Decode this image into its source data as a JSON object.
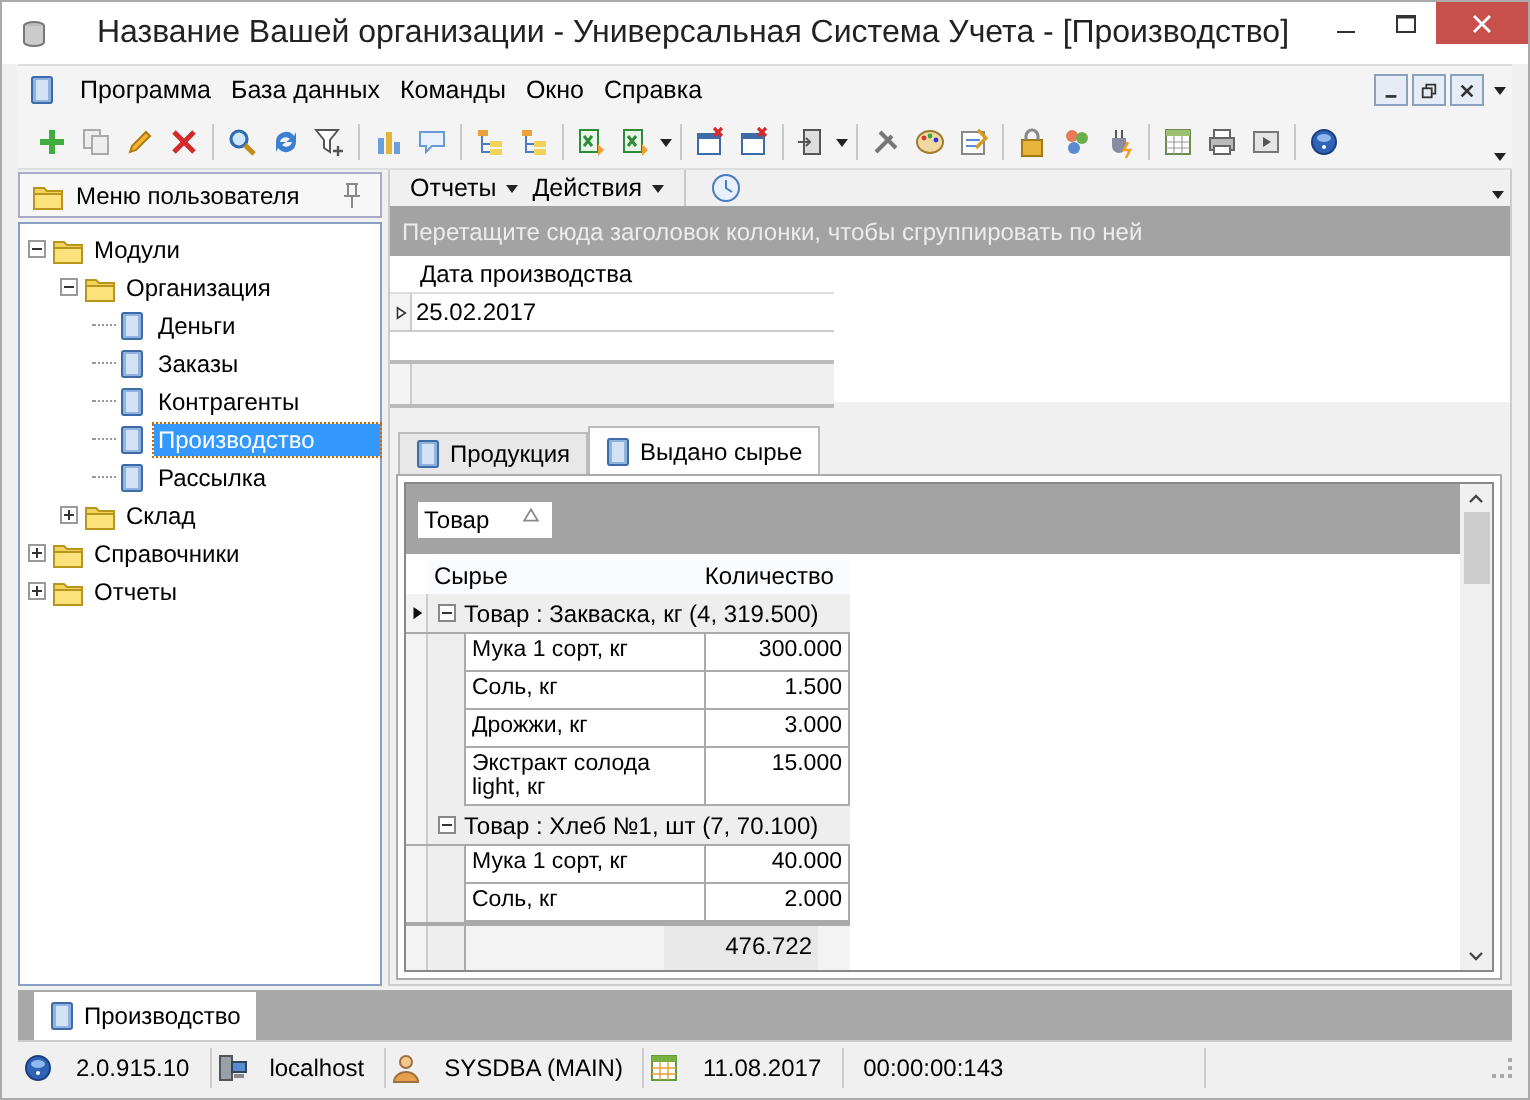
{
  "window": {
    "title": "Название Вашей организации - Универсальная Система Учета - [Производство]"
  },
  "menu": [
    "Программа",
    "База данных",
    "Команды",
    "Окно",
    "Справка"
  ],
  "sidebar": {
    "title": "Меню пользователя",
    "tree": [
      {
        "label": "Модули",
        "kind": "folder",
        "expanded": true,
        "selected": false,
        "children": [
          {
            "label": "Организация",
            "kind": "folder",
            "expanded": true,
            "selected": false,
            "children": [
              {
                "label": "Деньги",
                "kind": "page",
                "selected": false
              },
              {
                "label": "Заказы",
                "kind": "page",
                "selected": false
              },
              {
                "label": "Контрагенты",
                "kind": "page",
                "selected": false
              },
              {
                "label": "Производство",
                "kind": "page",
                "selected": true
              },
              {
                "label": "Рассылка",
                "kind": "page",
                "selected": false
              }
            ]
          },
          {
            "label": "Склад",
            "kind": "folder",
            "expanded": false,
            "selected": false
          }
        ]
      },
      {
        "label": "Справочники",
        "kind": "folder",
        "expanded": false,
        "selected": false
      },
      {
        "label": "Отчеты",
        "kind": "folder",
        "expanded": false,
        "selected": false
      }
    ]
  },
  "subtoolbar": [
    "Отчеты",
    "Действия"
  ],
  "master": {
    "group_hint": "Перетащите сюда заголовок колонки, чтобы сгруппировать по ней",
    "columns": [
      "Дата производства"
    ],
    "rows": [
      [
        "25.02.2017"
      ]
    ]
  },
  "detail_tabs": [
    {
      "label": "Продукция",
      "selected": false
    },
    {
      "label": "Выдано сырье",
      "selected": true
    }
  ],
  "detail": {
    "group_by": "Товар",
    "columns": [
      "Сырье",
      "Количество"
    ],
    "groups": [
      {
        "label": "Товар : Закваска, кг (4, 319.500)",
        "expanded": true,
        "current": true,
        "rows": [
          [
            "Мука 1 сорт, кг",
            "300.000"
          ],
          [
            "Соль, кг",
            "1.500"
          ],
          [
            "Дрожжи, кг",
            "3.000"
          ],
          [
            "Экстракт солода light, кг",
            "15.000"
          ]
        ]
      },
      {
        "label": "Товар : Хлеб №1, шт (7, 70.100)",
        "expanded": true,
        "current": false,
        "rows": [
          [
            "Мука 1 сорт, кг",
            "40.000"
          ],
          [
            "Соль, кг",
            "2.000"
          ]
        ]
      }
    ],
    "total": "476.722"
  },
  "document_tabs": [
    {
      "label": "Производство",
      "selected": true
    }
  ],
  "status_bar": [
    "2.0.915.10",
    "localhost",
    "SYSDBA (MAIN)",
    "11.08.2017",
    "00:00:00:143"
  ]
}
